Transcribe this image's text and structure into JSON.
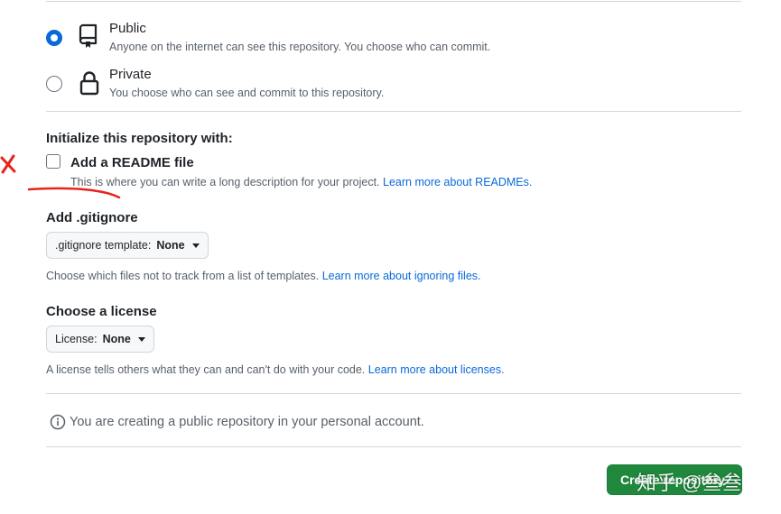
{
  "visibility": {
    "options": [
      {
        "title": "Public",
        "description": "Anyone on the internet can see this repository. You choose who can commit.",
        "selected": true,
        "icon": "repo-icon"
      },
      {
        "title": "Private",
        "description": "You choose who can see and commit to this repository.",
        "selected": false,
        "icon": "lock-icon"
      }
    ]
  },
  "initialize": {
    "heading": "Initialize this repository with:",
    "readme": {
      "label": "Add a README file",
      "checked": false,
      "help": "This is where you can write a long description for your project.",
      "link": "Learn more about READMEs."
    }
  },
  "gitignore": {
    "heading": "Add .gitignore",
    "dropdown_label": ".gitignore template:",
    "dropdown_value": "None",
    "help": "Choose which files not to track from a list of templates.",
    "link": "Learn more about ignoring files."
  },
  "license": {
    "heading": "Choose a license",
    "dropdown_label": "License:",
    "dropdown_value": "None",
    "help": "A license tells others what they can and can't do with your code.",
    "link": "Learn more about licenses."
  },
  "notice": {
    "text": "You are creating a public repository in your personal account.",
    "icon": "info-icon"
  },
  "create_button": {
    "label": "Create repository"
  },
  "watermark": {
    "text": "知乎 @叁叁"
  },
  "colors": {
    "accent": "#0969da",
    "button": "#1f883d",
    "annotation": "#e5241c"
  }
}
